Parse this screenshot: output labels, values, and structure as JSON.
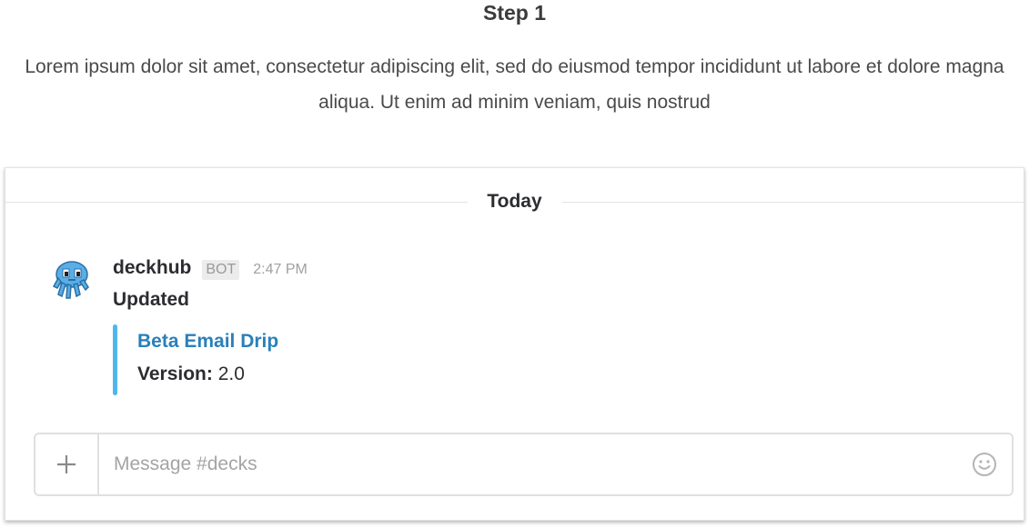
{
  "intro": {
    "step_title": "Step 1",
    "description": "Lorem ipsum dolor sit amet, consectetur adipiscing elit, sed do eiusmod tempor incididunt ut labore et dolore magna aliqua. Ut enim ad minim veniam, quis nostrud"
  },
  "channel": {
    "day_divider": "Today"
  },
  "message": {
    "avatar_icon": "octopus-bot-icon",
    "sender": "deckhub",
    "badge": "BOT",
    "time": "2:47 PM",
    "text": "Updated",
    "attachment": {
      "title": "Beta Email Drip",
      "field_name": "Version:",
      "field_value": "2.0",
      "color": "#4fb7eb"
    }
  },
  "composer": {
    "add_icon": "plus-icon",
    "placeholder": "Message #decks",
    "emoji_icon": "smiley-icon"
  },
  "colors": {
    "link": "#2a80b9",
    "attachment_bar": "#4fb7eb",
    "avatar": "#5aaee8"
  }
}
